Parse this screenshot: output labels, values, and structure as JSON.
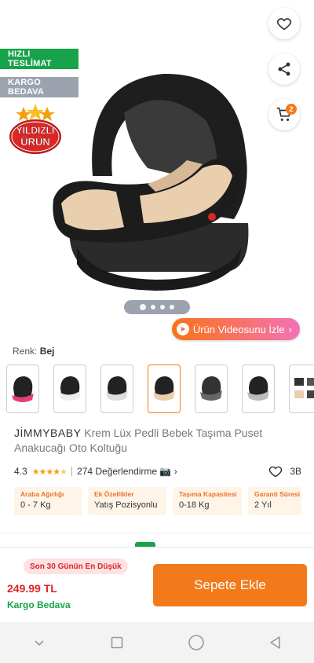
{
  "header": {
    "tags": {
      "fast_delivery": "HIZLI TESLİMAT",
      "free_cargo": "KARGO BEDAVA"
    },
    "badge": {
      "line1": "YILDIZLI",
      "line2": "ÜRÜN"
    },
    "cart_count": "2",
    "icons": [
      "back-arrow-icon",
      "heart-icon",
      "share-icon",
      "cart-icon"
    ]
  },
  "gallery": {
    "video_label": "Ürün Videosunu İzle",
    "dot_count": 4
  },
  "color": {
    "label": "Renk:",
    "value": "Bej"
  },
  "product": {
    "brand": "JİMMYBABY",
    "name": " Krem Lüx Pedli Bebek Taşıma  Puset Anakucağı Oto Koltuğu"
  },
  "rating": {
    "score": "4.3",
    "stars": 4.3,
    "reviews": "274 Değerlendirme",
    "favorites": "3B"
  },
  "specs": [
    {
      "label": "Araba Ağırlığı",
      "value": "0 - 7 Kg"
    },
    {
      "label": "Ek Özellikler",
      "value": "Yatış Pozisyonlu"
    },
    {
      "label": "Taşıma Kapasitesi",
      "value": "0-18 Kg"
    },
    {
      "label": "Garanti Süresi",
      "value": "2 Yıl"
    }
  ],
  "purchase": {
    "low_price_note": "Son 30 Günün En Düşük",
    "price": "249.99 TL",
    "cargo": "Kargo Bedava",
    "add_to_cart": "Sepete Ekle"
  },
  "colors": {
    "accent": "#f27a1a",
    "green": "#16a34a",
    "price_red": "#dc2626"
  }
}
